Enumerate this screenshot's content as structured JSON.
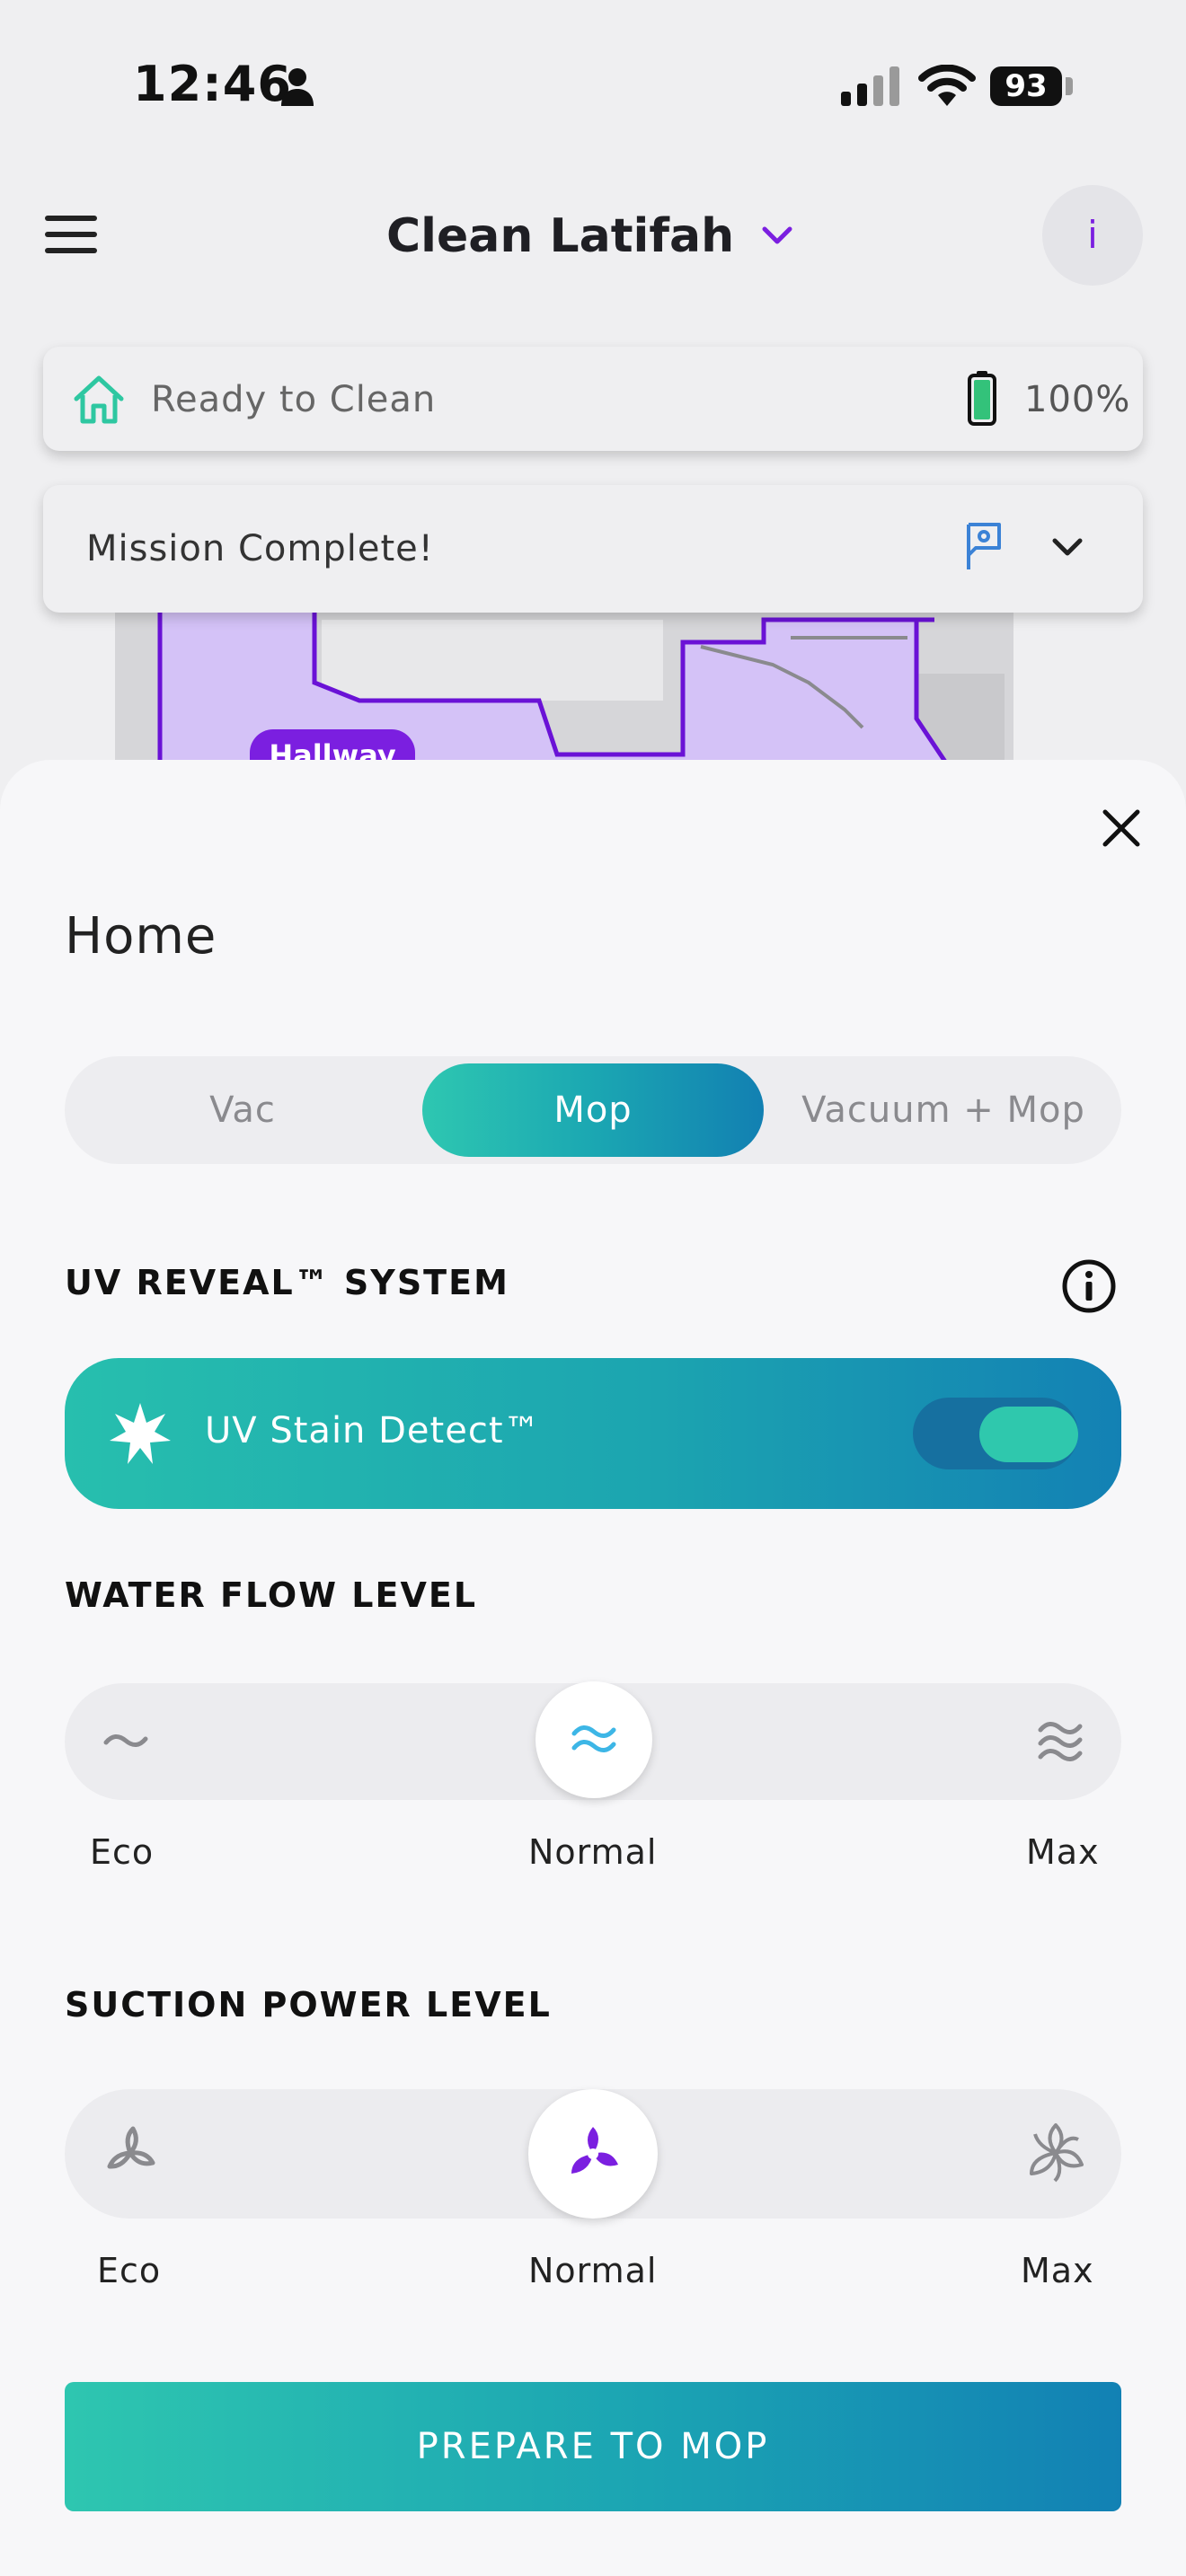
{
  "status_bar": {
    "time": "12:46",
    "battery_level": "93"
  },
  "header": {
    "title": "Clean Latifah",
    "info_label": "i"
  },
  "status_cards": {
    "ready_text": "Ready to Clean",
    "battery_percent": "100%",
    "mission_text": "Mission Complete!"
  },
  "map": {
    "room_label": "Hallway"
  },
  "sheet": {
    "title": "Home",
    "modes": [
      "Vac",
      "Mop",
      "Vacuum + Mop"
    ],
    "selected_mode": "Mop",
    "uv_section_label": "UV REVEAL™ SYSTEM",
    "uv_toggle_label": "UV Stain Detect™",
    "uv_toggle_on": true,
    "water_section_label": "WATER FLOW LEVEL",
    "water_levels": [
      "Eco",
      "Normal",
      "Max"
    ],
    "water_selected": "Normal",
    "suction_section_label": "SUCTION POWER LEVEL",
    "suction_levels": [
      "Eco",
      "Normal",
      "Max"
    ],
    "suction_selected": "Normal",
    "cta_label": "PREPARE TO MOP"
  },
  "colors": {
    "accent_purple": "#7b1fe0",
    "teal_start": "#2ec7b1",
    "teal_end": "#1280b2",
    "map_room": "#d4c2f7",
    "map_outline": "#6a12d6"
  }
}
